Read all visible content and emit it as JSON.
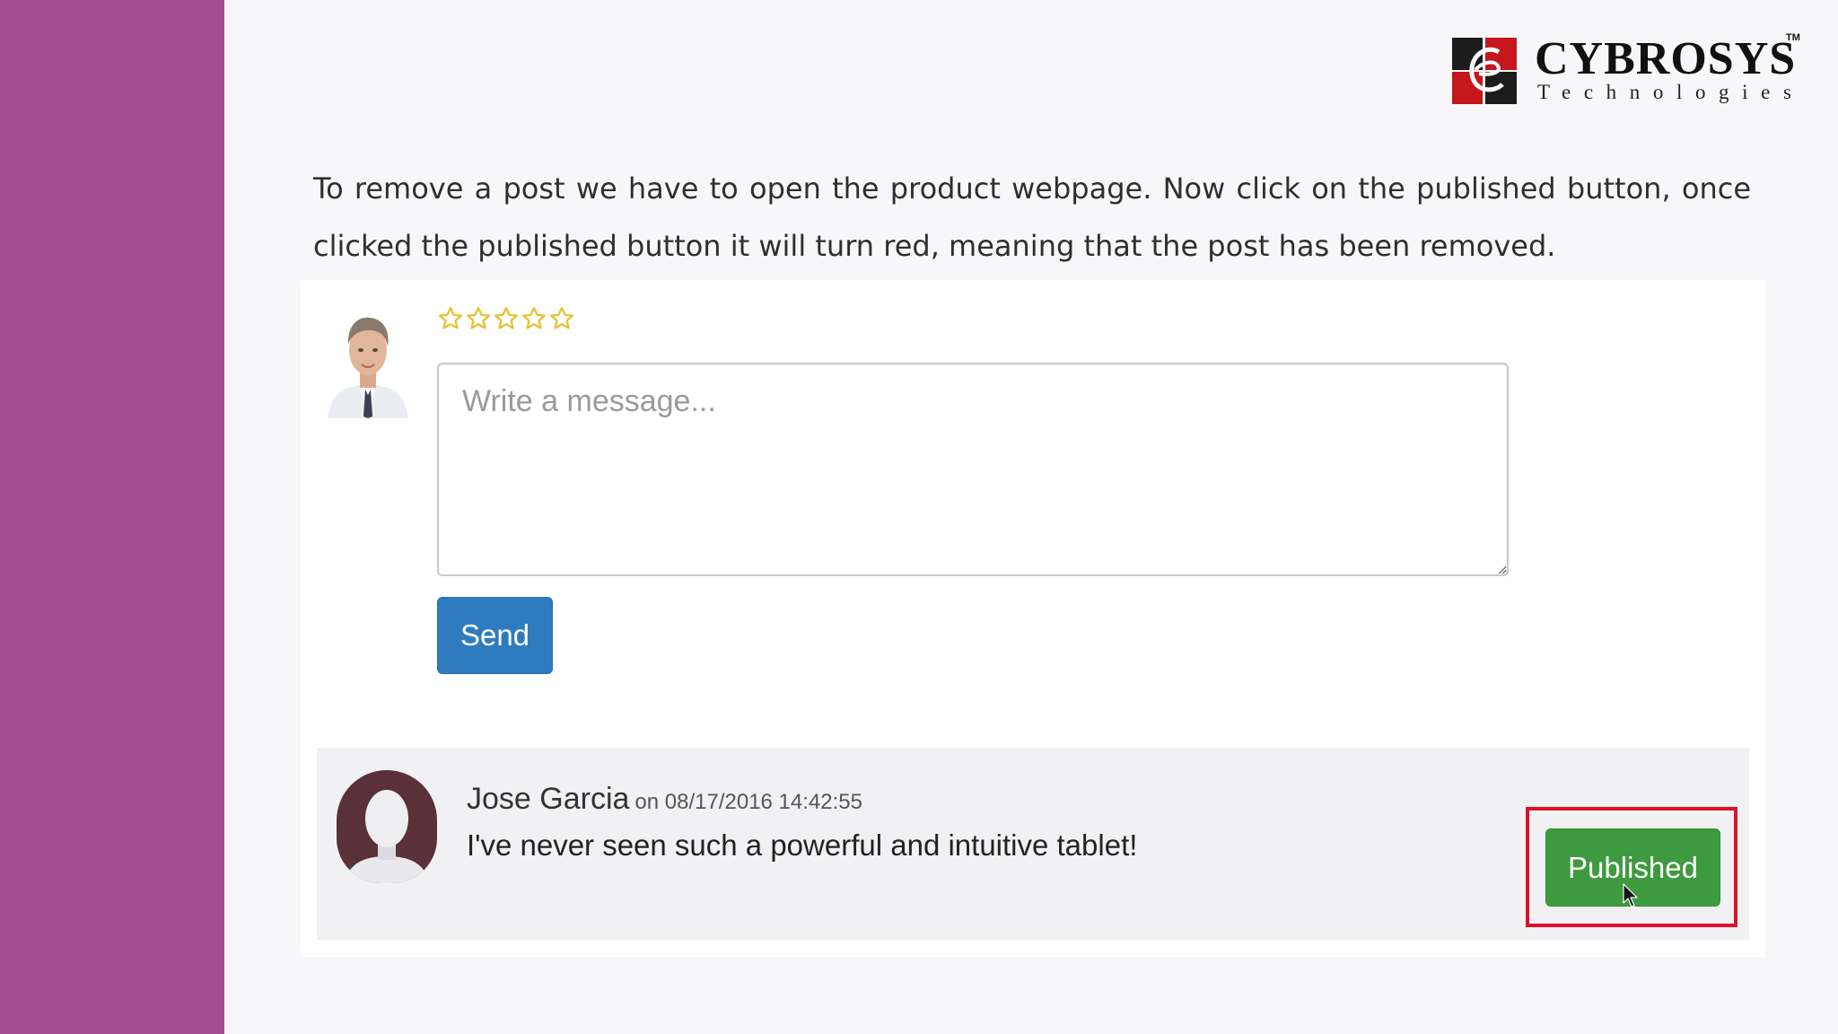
{
  "logo": {
    "name": "CYBROSYS",
    "trademark": "TM",
    "tagline": "Technologies"
  },
  "instruction": {
    "text": "To remove a post we have to open the product webpage. Now click on the published button, once clicked the published button it will turn red, meaning that the post has been removed."
  },
  "review_form": {
    "rating": 0,
    "rating_max": 5,
    "message_placeholder": "Write a message...",
    "send_label": "Send"
  },
  "comment": {
    "author": "Jose Garcia",
    "date": "on 08/17/2016 14:42:55",
    "text": "I've never seen such a powerful and intuitive tablet!",
    "status_label": "Published"
  },
  "colors": {
    "side_band": "#a54c93",
    "send_button": "#2f7bbf",
    "published_button": "#3e9a3e",
    "highlight": "#e0102a",
    "star": "#e8c12e"
  },
  "icons": [
    "cybrosys-logo-icon",
    "star-outline-icon",
    "user-avatar-icon",
    "anonymous-avatar-icon",
    "mouse-cursor-icon"
  ]
}
